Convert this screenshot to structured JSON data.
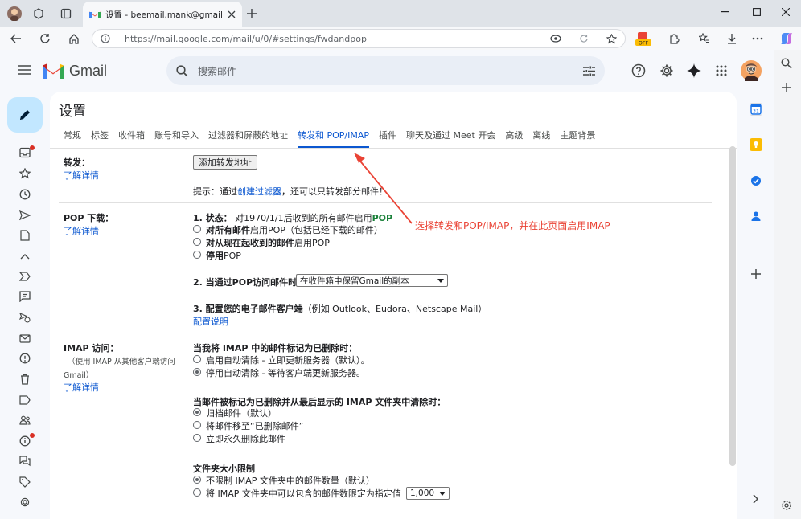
{
  "browser": {
    "tab_title": "设置 - beemail.mank@gmail.com",
    "url": "https://mail.google.com/mail/u/0/#settings/fwdandpop",
    "ext_badge": "OFF"
  },
  "gmail": {
    "logo_text": "Gmail",
    "search_placeholder": "搜索邮件"
  },
  "settings": {
    "title": "设置",
    "tabs": [
      {
        "label": "常规",
        "active": false
      },
      {
        "label": "标签",
        "active": false
      },
      {
        "label": "收件箱",
        "active": false
      },
      {
        "label": "账号和导入",
        "active": false
      },
      {
        "label": "过滤器和屏蔽的地址",
        "active": false
      },
      {
        "label": "转发和 POP/IMAP",
        "active": true
      },
      {
        "label": "插件",
        "active": false
      },
      {
        "label": "聊天及通过 Meet 开会",
        "active": false
      },
      {
        "label": "高级",
        "active": false
      },
      {
        "label": "离线",
        "active": false
      },
      {
        "label": "主题背景",
        "active": false
      }
    ],
    "forwarding": {
      "label": "转发：",
      "learn_more": "了解详情",
      "add_button": "添加转发地址",
      "hint_prefix": "提示：通过",
      "hint_link": "创建过滤器",
      "hint_suffix": "，还可以只转发部分邮件！"
    },
    "pop": {
      "label": "POP 下载：",
      "learn_more": "了解详情",
      "status_prefix": "1. 状态：",
      "status_text": "对1970/1/1后收到的所有邮件启用",
      "status_value": "POP",
      "options": [
        {
          "bold": "对所有邮件",
          "rest": "启用POP（包括已经下载的邮件）",
          "checked": false
        },
        {
          "bold": "对从现在起收到的邮件",
          "rest": "启用POP",
          "checked": false
        },
        {
          "bold": "停用",
          "rest": "POP",
          "checked": false
        }
      ],
      "step2_label": "2. 当通过POP访问邮件时",
      "step2_select": "在收件箱中保留Gmail的副本",
      "step3_label": "3. 配置您的电子邮件客户端",
      "step3_note": "（例如 Outlook、Eudora、Netscape Mail）",
      "step3_link": "配置说明"
    },
    "imap": {
      "label": "IMAP 访问：",
      "sublabel_1": "（使用 IMAP 从其他客户端访问",
      "sublabel_2": "Gmail）",
      "learn_more": "了解详情",
      "q1": "当我将 IMAP 中的邮件标记为已删除时：",
      "q1_options": [
        {
          "text": "启用自动清除 - 立即更新服务器（默认）。",
          "checked": false
        },
        {
          "text": "停用自动清除 - 等待客户端更新服务器。",
          "checked": true
        }
      ],
      "q2": "当邮件被标记为已删除并从最后显示的 IMAP 文件夹中清除时：",
      "q2_options": [
        {
          "text": "归档邮件（默认）",
          "checked": true
        },
        {
          "text": "将邮件移至“已删除邮件”",
          "checked": false
        },
        {
          "text": "立即永久删除此邮件",
          "checked": false
        }
      ],
      "q3": "文件夹大小限制",
      "q3_options": [
        {
          "text": "不限制 IMAP 文件夹中的邮件数量（默认）",
          "checked": true
        },
        {
          "text": "将 IMAP 文件夹中可以包含的邮件数限定为指定值",
          "checked": false
        }
      ],
      "limit_select": "1,000"
    }
  },
  "annotation": {
    "text": "选择转发和POP/IMAP，并在此页面启用IMAP",
    "color": "#ea4335"
  },
  "colors": {
    "accent": "#0b57d0",
    "compose_bg": "#c2e7ff",
    "pop_green": "#188038"
  }
}
